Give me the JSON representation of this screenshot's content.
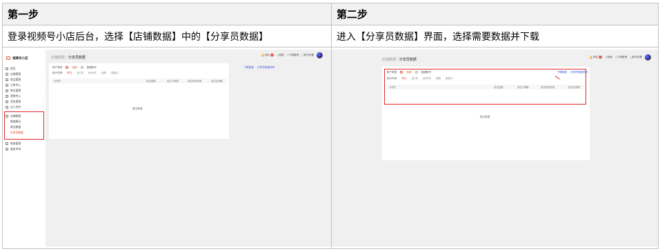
{
  "steps": [
    {
      "title": "第一步",
      "description": "登录视频号小店后台，选择【店铺数据】中的【分享员数据】"
    },
    {
      "title": "第二步",
      "description": "进入【分享员数据】界面，选择需要数据并下载"
    }
  ],
  "left_shot": {
    "logo": "视频号小店",
    "nav": [
      "首页",
      "店铺管理",
      "商品管理",
      "订单中心",
      "售后管理",
      "营销中心",
      "资金管理",
      "达人合作",
      "店铺数据",
      "数据概况",
      "商品数据",
      "分享员数据",
      "物流管理",
      "服务市场"
    ],
    "breadcrumb_parent": "店铺数据",
    "breadcrumb_current": "分享员数据",
    "topbar": [
      "消息",
      "客服",
      "下载管理",
      "账号设置"
    ],
    "badge": "99",
    "filter_label": "账户类型",
    "filter_on": "全部",
    "filter_off": "普通账号",
    "tabs": [
      "昨日",
      "近7天",
      "近30天",
      "自然",
      "自定义"
    ],
    "links": [
      "下载数据",
      "分享员数据说明"
    ],
    "columns": [
      "分享员",
      "成交金额",
      "成交订单数",
      "成交商品件数",
      "成交买家数"
    ],
    "empty_text": "暂无数据"
  },
  "right_shot": {
    "breadcrumb_parent": "店铺数据",
    "breadcrumb_current": "分享员数据",
    "topbar": [
      "消息",
      "客服",
      "下载管理",
      "账号设置"
    ],
    "badge": "99",
    "filter_label": "账户类型",
    "filter_on": "全部",
    "filter_off": "普通账号",
    "tabs": [
      "昨日",
      "近7天",
      "近30天",
      "自然",
      "自定义"
    ],
    "links": [
      "下载数据",
      "分享员数据说明"
    ],
    "columns": [
      "分享员",
      "成交金额",
      "成交订单数",
      "成交商品件数",
      "成交买家数"
    ],
    "empty_text": "暂无数据"
  },
  "colors": {
    "accent": "#e0462a",
    "highlight_box": "#e0282a",
    "header_bg": "#f2f2f2",
    "border": "#bfbfbf"
  }
}
